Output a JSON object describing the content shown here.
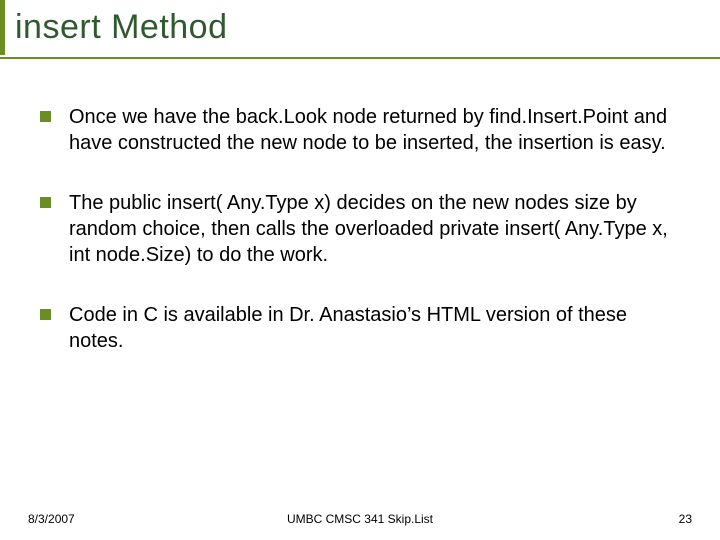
{
  "title": "insert Method",
  "bullets": [
    "Once we have the back.Look node returned by find.Insert.Point and have constructed the new node to be inserted, the insertion is easy.",
    "The public insert( Any.Type x) decides on the new nodes size by random choice, then calls the overloaded private insert( Any.Type x, int node.Size) to do the work.",
    "Code in C is available in Dr. Anastasio’s HTML version of these notes."
  ],
  "footer": {
    "date": "8/3/2007",
    "course": "UMBC CMSC 341 Skip.List",
    "page": "23"
  },
  "colors": {
    "accent": "#6b8e23",
    "titleText": "#2f5a2f"
  }
}
